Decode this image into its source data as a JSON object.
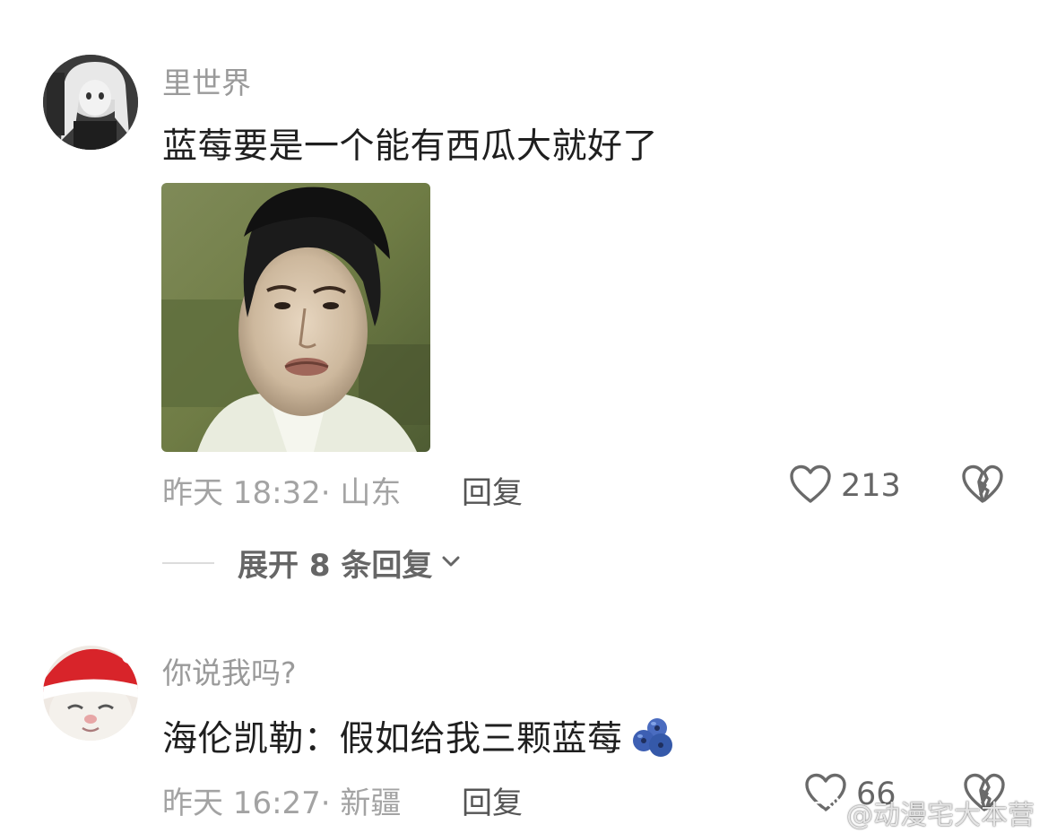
{
  "comments": [
    {
      "username": "里世界",
      "text": "蓝莓要是一个能有西瓜大就好了",
      "time": "昨天 18:32",
      "location": "· 山东",
      "reply_label": "回复",
      "likes": "213",
      "expand_label": "展开 8 条回复"
    },
    {
      "username": "你说我吗?",
      "text": "海伦凯勒：假如给我三颗蓝莓",
      "time": "昨天 16:27",
      "location": "· 新疆",
      "reply_label": "回复",
      "likes": "66"
    }
  ],
  "watermark": {
    "text": "@动漫宅大本营"
  },
  "icons": {
    "like": "heart-outline-icon",
    "dislike": "broken-heart-icon",
    "expand": "chevron-down-icon",
    "emoji": "blueberry-emoji-icon",
    "weibo": "weibo-logo-icon"
  },
  "colors": {
    "username": "#9a9a9a",
    "text": "#1f1f1f",
    "meta": "#a3a3a3",
    "icon": "#6a6a6a"
  }
}
